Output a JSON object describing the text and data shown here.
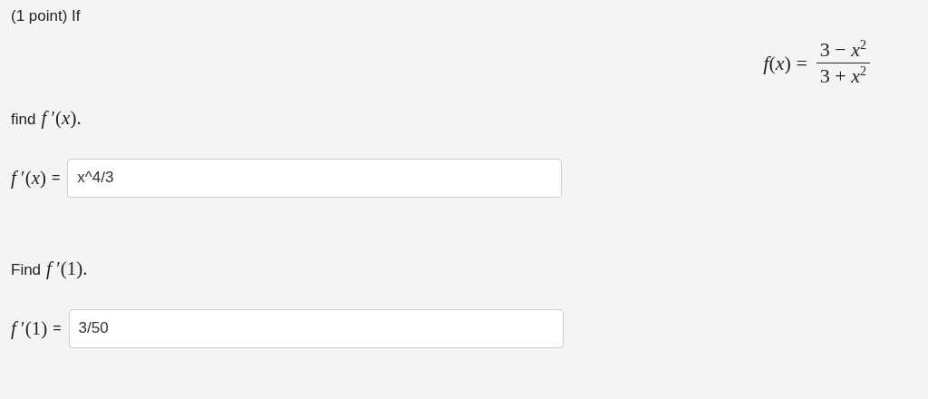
{
  "header": {
    "text": "(1 point) If"
  },
  "equation": {
    "lhs": "*f*(*x*) =",
    "numerator": "3 − *x*$^{2}$",
    "denominator": "3 + *x*$^{2}$"
  },
  "parts": [
    {
      "prompt": "find",
      "prompt_math": "*f* ′(*x*).",
      "answer_label": "*f* ′(*x*)",
      "equals": "=",
      "value": "x^4/3"
    },
    {
      "prompt": "Find",
      "prompt_math": "*f* ′(1).",
      "answer_label": "*f* ′(1)",
      "equals": "=",
      "value": "3/50"
    }
  ]
}
